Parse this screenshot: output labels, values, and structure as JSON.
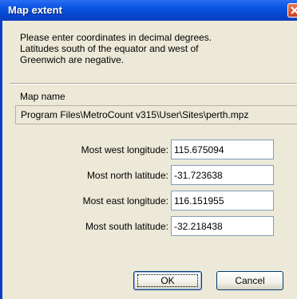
{
  "window": {
    "title": "Map extent"
  },
  "instructions": [
    "Please enter coordinates in decimal degrees.",
    "Latitudes south of the equator and west of",
    "Greenwich are negative."
  ],
  "map_name": {
    "label": "Map name",
    "value": "Program Files\\MetroCount v315\\User\\Sites\\perth.mpz"
  },
  "fields": {
    "west": {
      "label": "Most west longitude:",
      "value": "115.675094"
    },
    "north": {
      "label": "Most north latitude:",
      "value": "-31.723638"
    },
    "east": {
      "label": "Most east longitude:",
      "value": "116.151955"
    },
    "south": {
      "label": "Most south latitude:",
      "value": "-32.218438"
    }
  },
  "buttons": {
    "ok": "OK",
    "cancel": "Cancel"
  }
}
